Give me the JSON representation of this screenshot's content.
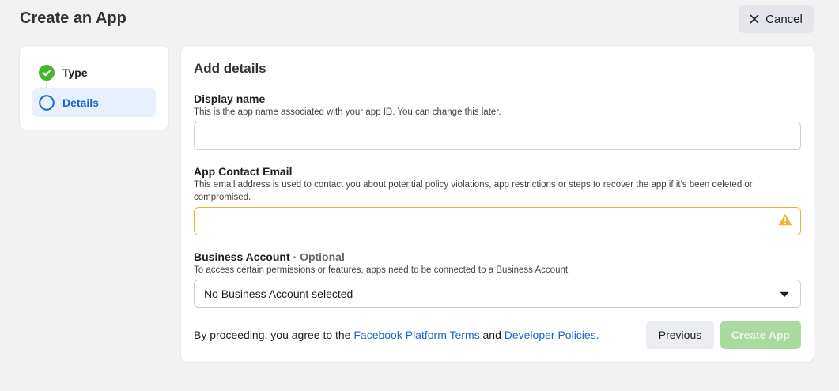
{
  "header": {
    "title": "Create an App",
    "cancel_label": "Cancel"
  },
  "steps": [
    {
      "label": "Type",
      "status": "complete"
    },
    {
      "label": "Details",
      "status": "current"
    }
  ],
  "form": {
    "section_title": "Add details",
    "display_name": {
      "label": "Display name",
      "help": "This is the app name associated with your app ID. You can change this later.",
      "value": ""
    },
    "contact_email": {
      "label": "App Contact Email",
      "help": "This email address is used to contact you about potential policy violations, app restrictions or steps to recover the app if it's been deleted or compromised.",
      "value": "",
      "state": "warning"
    },
    "business_account": {
      "label": "Business Account",
      "optional": "· Optional",
      "help": "To access certain permissions or features, apps need to be connected to a Business Account.",
      "selected": "No Business Account selected"
    },
    "footer": {
      "prefix": "By proceeding, you agree to the ",
      "terms_link": "Facebook Platform Terms",
      "middle": " and ",
      "policies_link": "Developer Policies."
    },
    "previous_label": "Previous",
    "create_label": "Create App"
  },
  "colors": {
    "accent_blue": "#1b66c9",
    "success_green": "#42b72a",
    "warning_yellow": "#f5b02e",
    "disabled_green": "#a9dba0"
  }
}
